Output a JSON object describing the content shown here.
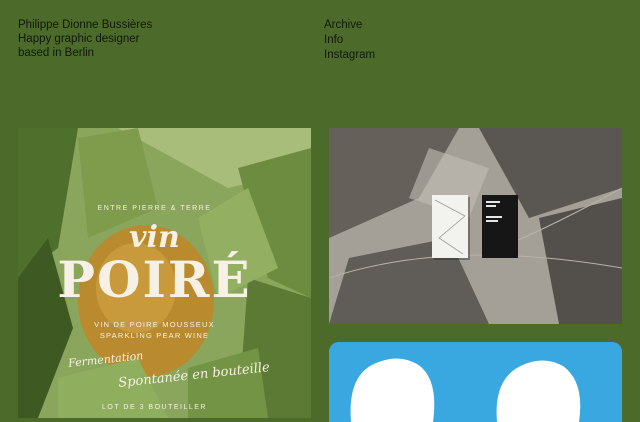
{
  "intro": {
    "line1": "Philippe Dionne Bussières",
    "line2": "Happy graphic designer",
    "line3": "based in Berlin"
  },
  "nav": [
    {
      "label": "Archive"
    },
    {
      "label": "Info"
    },
    {
      "label": "Instagram"
    }
  ],
  "projects": {
    "poire": {
      "top_label": "ENTRE PIERRE & TERRE",
      "vin": "vin",
      "poire": "POIRÉ",
      "sub1": "VIN DE POIRE MOUSSEUX",
      "sub2": "SPARKLING PEAR WINE",
      "hand1": "Fermentation",
      "hand2": "Spontanée en bouteille",
      "lot": "LOT DE  3  BOUTEILLER"
    }
  },
  "colors": {
    "background": "#4c6a2a",
    "text": "#10180a",
    "blue_tile": "#3aa8e0"
  }
}
